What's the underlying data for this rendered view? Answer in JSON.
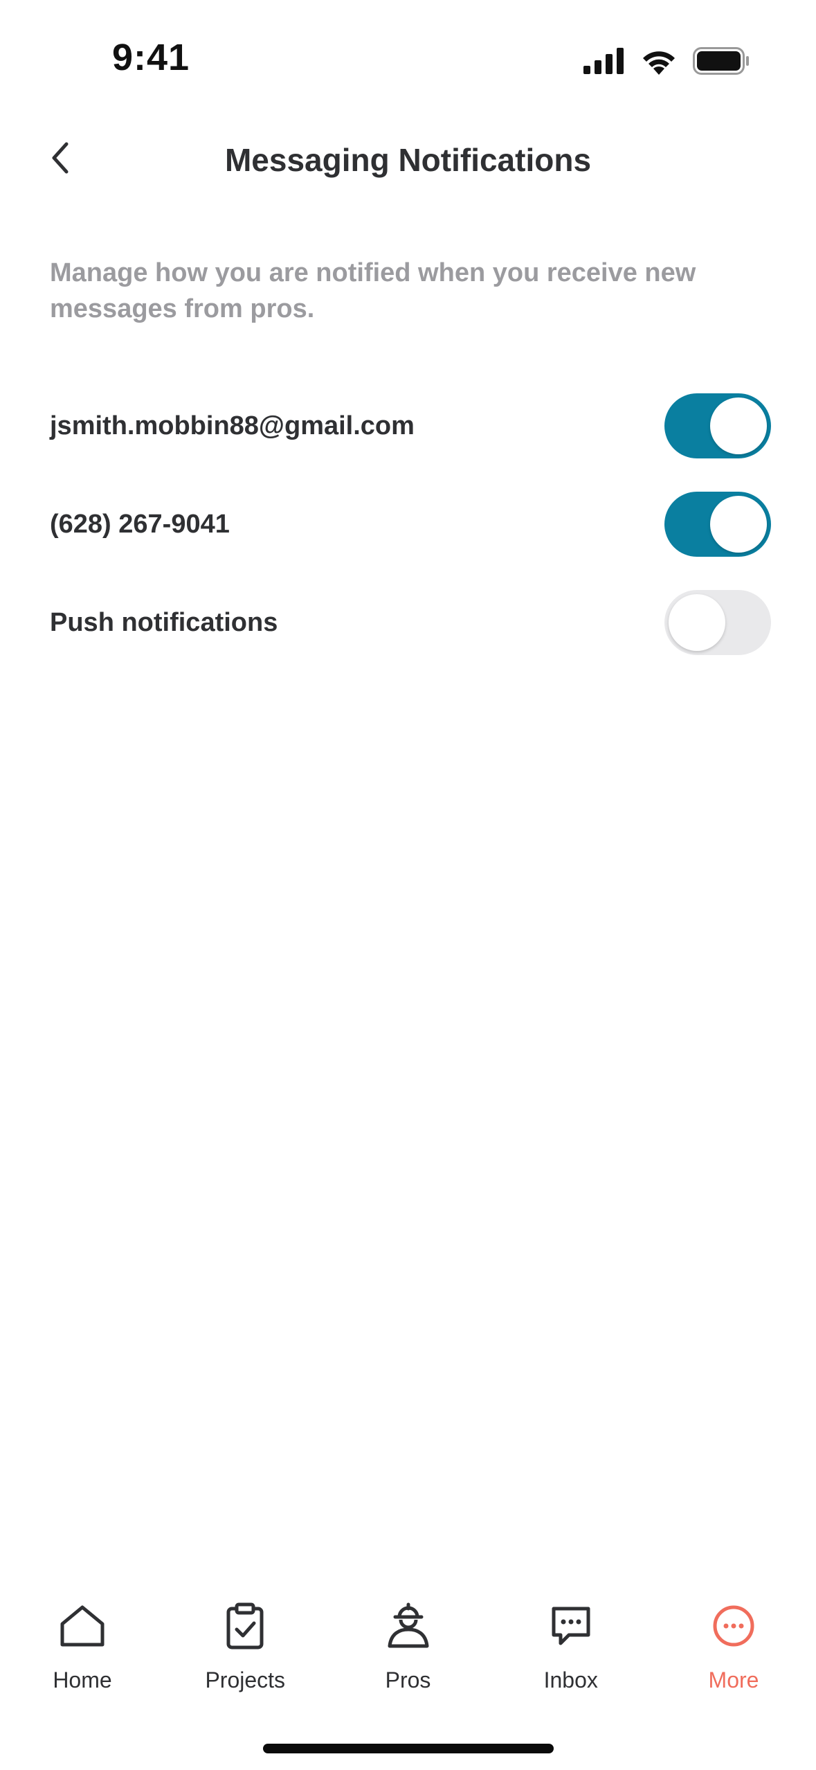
{
  "status_bar": {
    "time": "9:41",
    "icons": [
      "cellular-signal-icon",
      "wifi-icon",
      "battery-icon"
    ]
  },
  "header": {
    "title": "Messaging Notifications",
    "back_icon": "chevron-left-icon"
  },
  "description": "Manage how you are notified when you receive new messages from pros.",
  "settings": [
    {
      "label": "jsmith.mobbin88@gmail.com",
      "enabled": true
    },
    {
      "label": "(628) 267-9041",
      "enabled": true
    },
    {
      "label": "Push notifications",
      "enabled": false
    }
  ],
  "tab_bar": {
    "tabs": [
      {
        "label": "Home",
        "icon": "home-icon",
        "active": false
      },
      {
        "label": "Projects",
        "icon": "clipboard-check-icon",
        "active": false
      },
      {
        "label": "Pros",
        "icon": "pro-worker-icon",
        "active": false
      },
      {
        "label": "Inbox",
        "icon": "chat-bubble-icon",
        "active": false
      },
      {
        "label": "More",
        "icon": "more-circle-icon",
        "active": true
      }
    ]
  },
  "colors": {
    "toggle_on": "#0a7fa0",
    "toggle_off": "#e9e9eb",
    "active_tab": "#f06d5c",
    "text_primary": "#2f3033",
    "text_secondary": "#9b9b9f"
  }
}
